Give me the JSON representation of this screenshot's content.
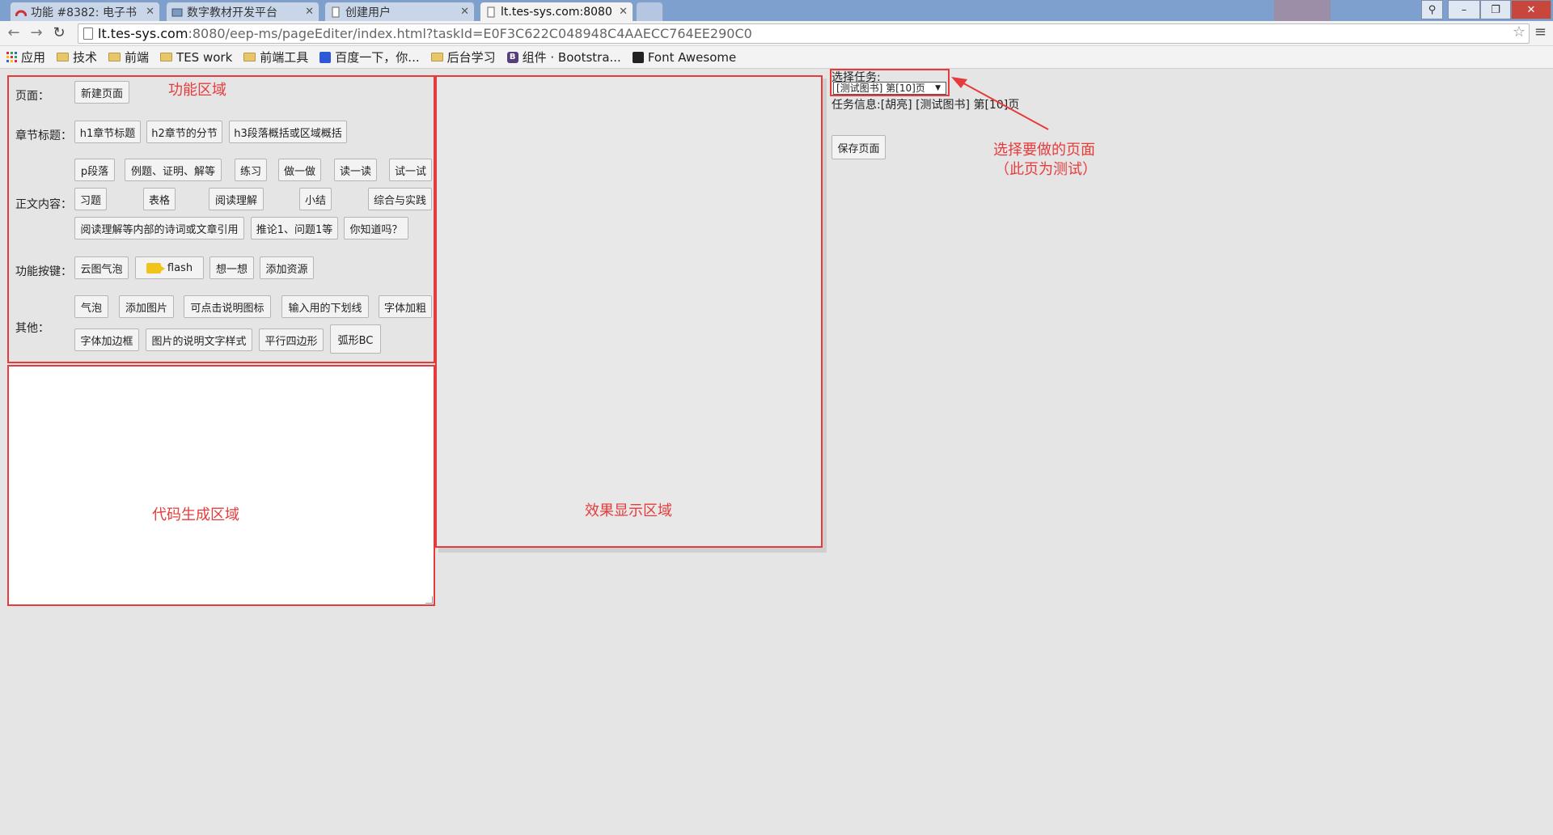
{
  "browser": {
    "tabs": [
      {
        "title": "功能 #8382: 电子书",
        "active": false
      },
      {
        "title": "数字教材开发平台",
        "active": false
      },
      {
        "title": "创建用户",
        "active": false
      },
      {
        "title": "lt.tes-sys.com:8080",
        "active": true
      }
    ],
    "url_host": "lt.tes-sys.com",
    "url_rest": ":8080/eep-ms/pageEditer/index.html?taskId=E0F3C622C048948C4AAECC764EE290C0",
    "bookmarks": [
      "应用",
      "技术",
      "前端",
      "TES work",
      "前端工具",
      "百度一下，你...",
      "后台学习",
      "组件 · Bootstra...",
      "Font Awesome"
    ],
    "window_buttons": {
      "minimize": "–",
      "restore": "❐",
      "close": "✕"
    }
  },
  "annotations": {
    "function_area": "功能区域",
    "code_area": "代码生成区域",
    "effect_area": "效果显示区域",
    "select_page_line1": "选择要做的页面",
    "select_page_line2": "（此页为测试）"
  },
  "function_panel": {
    "page_label": "页面：",
    "new_page": "新建页面",
    "chapter_label": "章节标题：",
    "chapter_buttons": [
      "h1章节标题",
      "h2章节的分节",
      "h3段落概括或区域概括"
    ],
    "body_label": "正文内容：",
    "body_row1": [
      "p段落",
      "例题、证明、解等",
      "练习",
      "做一做",
      "读一读",
      "试一试"
    ],
    "body_row2": [
      "习题",
      "表格",
      "阅读理解",
      "小结",
      "综合与实践"
    ],
    "body_row3": [
      "阅读理解等内部的诗词或文章引用",
      "推论1、问题1等",
      "你知道吗？"
    ],
    "func_label": "功能按键：",
    "func_buttons": [
      "云图气泡",
      "flash",
      "想一想",
      "添加资源"
    ],
    "other_label": "其他：",
    "other_row1": [
      "气泡",
      "添加图片",
      "可点击说明图标",
      "输入用的下划线",
      "字体加粗"
    ],
    "other_row2": [
      "字体加边框",
      "图片的说明文字样式",
      "平行四边形",
      "弧形BC"
    ]
  },
  "task": {
    "label": "选择任务:",
    "selected": "[测试图书] 第[10]页",
    "info": "任务信息:[胡亮] [测试图书] 第[10]页",
    "save": "保存页面"
  },
  "colors": {
    "annotation_red": "#e63b3b",
    "flash_icon": "#f2c417"
  }
}
